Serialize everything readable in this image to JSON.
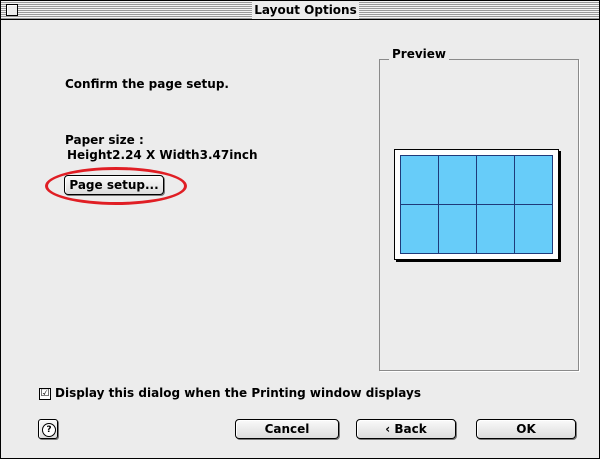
{
  "window": {
    "title": "Layout Options"
  },
  "main": {
    "instruction": "Confirm the page setup.",
    "paper_size_label": "Paper size :",
    "paper_size_value": "Height2.24 X Width3.47inch",
    "page_setup_button": "Page setup..."
  },
  "preview": {
    "label": "Preview",
    "rows": 2,
    "columns": 4
  },
  "options": {
    "display_dialog_checked": true,
    "display_dialog_check_glyph": "☑",
    "display_dialog_label": "Display this dialog when the Printing window displays"
  },
  "buttons": {
    "help_icon": "?",
    "cancel": "Cancel",
    "back": "‹ Back",
    "ok": "OK"
  },
  "colors": {
    "highlight": "#e01e24",
    "preview_cell": "#67ccf9",
    "preview_border": "#1f3a7a"
  }
}
